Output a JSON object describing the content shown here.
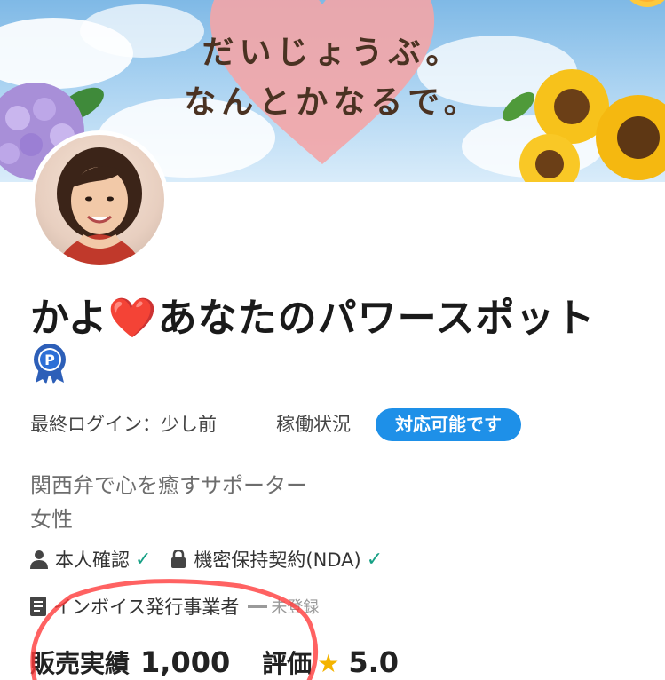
{
  "banner": {
    "line1": "だいじょうぶ。",
    "line2": "なんとかなるで。"
  },
  "profile": {
    "name_prefix": "かよ",
    "name_heart": "❤️",
    "name_suffix": "あなたのパワースポット",
    "badge_letter": "P",
    "last_login_label": "最終ログイン：",
    "last_login_value": "少し前",
    "status_label": "稼働状況",
    "status_value": "対応可能です",
    "catchphrase": "関西弁で心を癒すサポーター",
    "gender": "女性"
  },
  "verifications": {
    "identity": "本人確認",
    "nda": "機密保持契約(NDA)",
    "check": "✓",
    "invoice": "インボイス発行事業者",
    "invoice_status": "未登録"
  },
  "stats": {
    "sales_label": "販売実績",
    "sales_value": "1,000",
    "rating_label": "評価",
    "rating_star": "★",
    "rating_value": "5.0"
  },
  "colors": {
    "accent": "#1e90e8",
    "check": "#16a085",
    "star": "#f4b400",
    "annotation": "#ff3b3b"
  }
}
